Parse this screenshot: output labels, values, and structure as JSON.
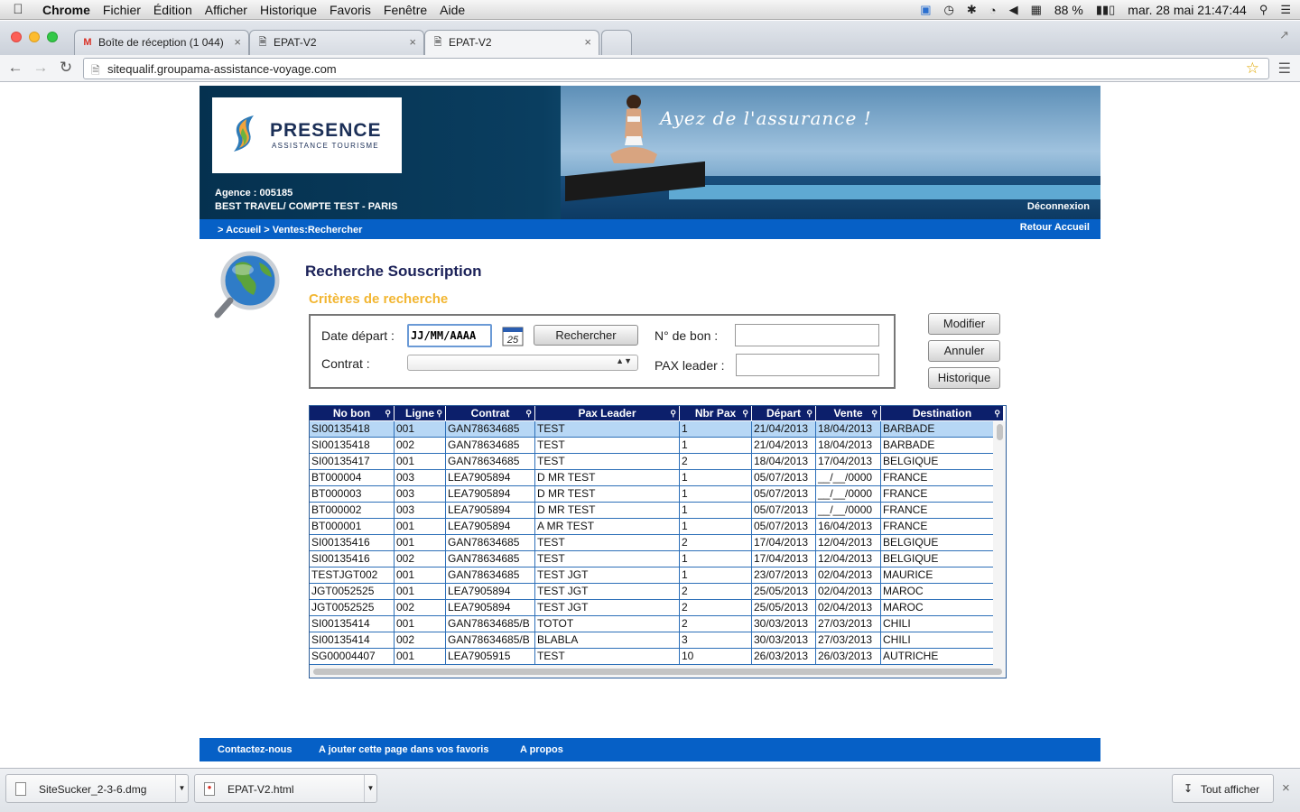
{
  "os_menubar": {
    "app": "Chrome",
    "menus": [
      "Fichier",
      "Édition",
      "Afficher",
      "Historique",
      "Favoris",
      "Fenêtre",
      "Aide"
    ],
    "battery": "88 %",
    "datetime": "mar. 28 mai  21:47:44"
  },
  "browser": {
    "tabs": [
      {
        "title": "Boîte de réception (1 044)",
        "icon": "gmail-icon"
      },
      {
        "title": "EPAT-V2",
        "icon": "page-icon"
      },
      {
        "title": "EPAT-V2",
        "icon": "page-icon",
        "active": true
      }
    ],
    "url": "sitequalif.groupama-assistance-voyage.com"
  },
  "header": {
    "logo_title": "PRESENCE",
    "logo_subtitle": "ASSISTANCE TOURISME",
    "slogan": "Ayez de l'assurance !",
    "agence_label": "Agence :  005185",
    "agence_name": "BEST TRAVEL/ COMPTE TEST - PARIS",
    "logout": "Déconnexion",
    "breadcrumb": "> Accueil > Ventes:Rechercher",
    "back_home": "Retour Accueil"
  },
  "search": {
    "title": "Recherche Souscription",
    "criteria_title": "Critères de recherche",
    "date_label": "Date départ :",
    "date_value": "JJ/MM/AAAA",
    "calendar_day": "25",
    "search_button": "Rechercher",
    "bon_label": "N° de bon :",
    "bon_value": "",
    "contrat_label": "Contrat :",
    "contrat_value": "",
    "pax_label": "PAX leader :",
    "pax_value": ""
  },
  "actions": {
    "modify": "Modifier",
    "cancel": "Annuler",
    "history": "Historique"
  },
  "table": {
    "columns": [
      "No bon",
      "Ligne",
      "Contrat",
      "Pax Leader",
      "Nbr Pax",
      "Départ",
      "Vente",
      "Destination"
    ],
    "rows": [
      [
        "SI00135418",
        "001",
        "GAN78634685",
        "TEST",
        "1",
        "21/04/2013",
        "18/04/2013",
        "BARBADE"
      ],
      [
        "SI00135418",
        "002",
        "GAN78634685",
        "TEST",
        "1",
        "21/04/2013",
        "18/04/2013",
        "BARBADE"
      ],
      [
        "SI00135417",
        "001",
        "GAN78634685",
        "TEST",
        "2",
        "18/04/2013",
        "17/04/2013",
        "BELGIQUE"
      ],
      [
        "BT000004",
        "003",
        "LEA7905894",
        "D MR TEST",
        "1",
        "05/07/2013",
        "__/__/0000",
        "FRANCE"
      ],
      [
        "BT000003",
        "003",
        "LEA7905894",
        "D MR TEST",
        "1",
        "05/07/2013",
        "__/__/0000",
        "FRANCE"
      ],
      [
        "BT000002",
        "003",
        "LEA7905894",
        "D MR TEST",
        "1",
        "05/07/2013",
        "__/__/0000",
        "FRANCE"
      ],
      [
        "BT000001",
        "001",
        "LEA7905894",
        "A MR TEST",
        "1",
        "05/07/2013",
        "16/04/2013",
        "FRANCE"
      ],
      [
        "SI00135416",
        "001",
        "GAN78634685",
        "TEST",
        "2",
        "17/04/2013",
        "12/04/2013",
        "BELGIQUE"
      ],
      [
        "SI00135416",
        "002",
        "GAN78634685",
        "TEST",
        "1",
        "17/04/2013",
        "12/04/2013",
        "BELGIQUE"
      ],
      [
        "TESTJGT002",
        "001",
        "GAN78634685",
        "TEST JGT",
        "1",
        "23/07/2013",
        "02/04/2013",
        "MAURICE"
      ],
      [
        "JGT0052525",
        "001",
        "LEA7905894",
        "TEST JGT",
        "2",
        "25/05/2013",
        "02/04/2013",
        "MAROC"
      ],
      [
        "JGT0052525",
        "002",
        "LEA7905894",
        "TEST JGT",
        "2",
        "25/05/2013",
        "02/04/2013",
        "MAROC"
      ],
      [
        "SI00135414",
        "001",
        "GAN78634685/B",
        "TOTOT",
        "2",
        "30/03/2013",
        "27/03/2013",
        "CHILI"
      ],
      [
        "SI00135414",
        "002",
        "GAN78634685/B",
        "BLABLA",
        "3",
        "30/03/2013",
        "27/03/2013",
        "CHILI"
      ],
      [
        "SG00004407",
        "001",
        "LEA7905915",
        "TEST",
        "10",
        "26/03/2013",
        "26/03/2013",
        "AUTRICHE"
      ]
    ]
  },
  "footer": {
    "contact": "Contactez-nous",
    "favorites": "A jouter cette page dans vos favoris",
    "about": "A propos"
  },
  "downloads": {
    "items": [
      "SiteSucker_2-3-6.dmg",
      "EPAT-V2.html"
    ],
    "show_all": "Tout afficher"
  },
  "colors": {
    "header_blue": "#0660c6",
    "table_header": "#0c1f6b",
    "selected_row": "#b7d7f5",
    "criteria_title": "#f2b632",
    "page_title": "#1b2158"
  }
}
